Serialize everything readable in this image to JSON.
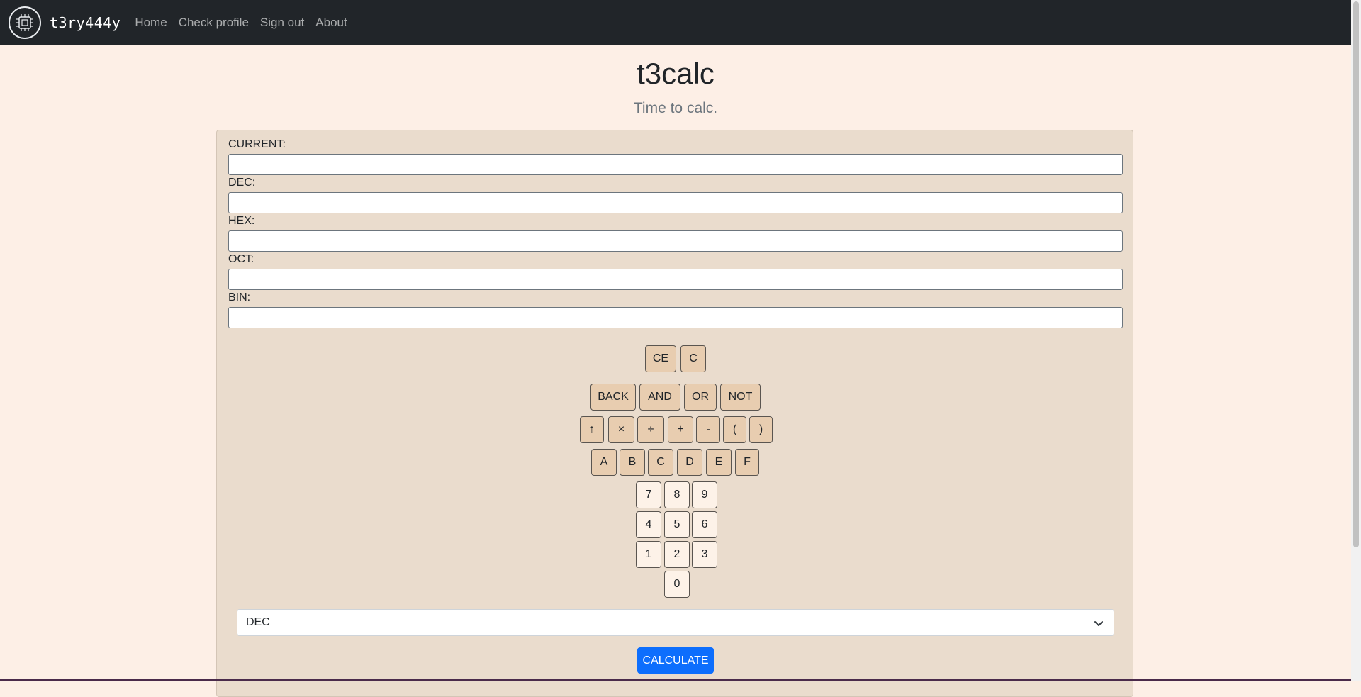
{
  "nav": {
    "brand": "t3ry444y",
    "links": [
      "Home",
      "Check profile",
      "Sign out",
      "About"
    ]
  },
  "header": {
    "title": "t3calc",
    "subtitle": "Time to calc."
  },
  "fields": [
    {
      "label": "CURRENT:",
      "value": ""
    },
    {
      "label": "DEC:",
      "value": ""
    },
    {
      "label": "HEX:",
      "value": ""
    },
    {
      "label": "OCT:",
      "value": ""
    },
    {
      "label": "BIN:",
      "value": ""
    }
  ],
  "keypad": {
    "clear_row": [
      "CE",
      "C"
    ],
    "logic_row": [
      "BACK",
      "AND",
      "OR",
      "NOT"
    ],
    "operator_row": [
      "↑",
      "×",
      "÷",
      "+",
      "-",
      "(",
      ")"
    ],
    "hex_row": [
      "A",
      "B",
      "C",
      "D",
      "E",
      "F"
    ],
    "digit_rows": [
      [
        "7",
        "8",
        "9"
      ],
      [
        "4",
        "5",
        "6"
      ],
      [
        "1",
        "2",
        "3"
      ],
      [
        "0"
      ]
    ]
  },
  "base_select": {
    "selected": "DEC"
  },
  "calculate_label": "CALCULATE",
  "colors": {
    "navbar": "#212529",
    "background": "#fdefe6",
    "card": "#eadccd",
    "key": "#e8cdb0",
    "digit_key": "#fdf2e8",
    "primary": "#0d6efd"
  },
  "icons": {
    "logo": "chip-logo-icon",
    "select": "chevron-down-icon"
  }
}
